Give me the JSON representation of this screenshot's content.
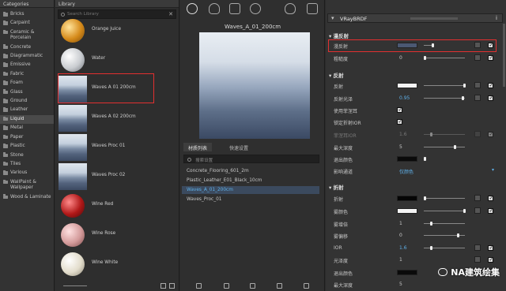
{
  "categories": {
    "title": "Categories",
    "items": [
      "Bricks",
      "Carpaint",
      "Ceramic & Porcelain",
      "Concrete",
      "Diagrammatic",
      "Emissive",
      "Fabric",
      "Foam",
      "Glass",
      "Ground",
      "Leather",
      "Liquid",
      "Metal",
      "Paper",
      "Plastic",
      "Stone",
      "Tiles",
      "Various",
      "WallPaint & Wallpaper",
      "Wood & Laminate"
    ],
    "active": "Liquid"
  },
  "library": {
    "title": "Library",
    "search_placeholder": "Search Library",
    "items": [
      "Orange Juice",
      "Water",
      "Waves A 01 200cm",
      "Waves A 02 200cm",
      "Waves Proc 01",
      "Waves Proc 02",
      "Wine Red",
      "Wine Rose",
      "Wine White"
    ]
  },
  "preview": {
    "title": "Waves_A_01_200cm"
  },
  "materials_panel": {
    "tabs": [
      "材质列表",
      "快速设置"
    ],
    "search_placeholder": "搜索设置",
    "items": [
      "Concrete_Flooring_601_2m",
      "Plastic_Leather_E01_Black_10cm",
      "Waves_A_01_200cm",
      "Waves_Proc_01"
    ],
    "selected": "Waves_A_01_200cm"
  },
  "props": {
    "header": "VRayBRDF",
    "diffuse_section": "漫反射",
    "diffuse_label": "漫反射",
    "roughness_label": "粗糙度",
    "roughness_value": "0",
    "reflection_section": "反射",
    "reflect_label": "反射",
    "glossiness_label": "反射光泽",
    "glossiness_value": "0.95",
    "fresnel_label": "使用菲涅耳",
    "lock_ior_label": "锁定折射IOR",
    "fresnel_ior_label": "菲涅耳IOR",
    "fresnel_ior_value": "1.6",
    "max_depth_label": "最大深度",
    "max_depth_value": "5",
    "exit_color_label": "退出颜色",
    "affect_channels_label": "影响通道",
    "affect_channels_value": "仅颜色",
    "refraction_section": "折射",
    "refr_color_label": "折射",
    "fog_color_label": "雾颜色",
    "fog_mult_label": "雾增倍",
    "fog_bias_label": "雾偏移",
    "fog_mult_value": "1",
    "fog_bias_value": "0",
    "ior_label": "IOR",
    "ior_value": "1.6",
    "refr_gloss_label": "光泽度",
    "refr_gloss_value": "1",
    "refr_exit_label": "退出颜色",
    "refr_depth_label": "最大深度",
    "refr_depth_value": "5"
  },
  "watermark": "NA建筑绘集",
  "colors": {
    "highlight_red": "#e23030",
    "diffuse_swatch": "#4b5872",
    "selected_blue": "#5fb0e8"
  }
}
